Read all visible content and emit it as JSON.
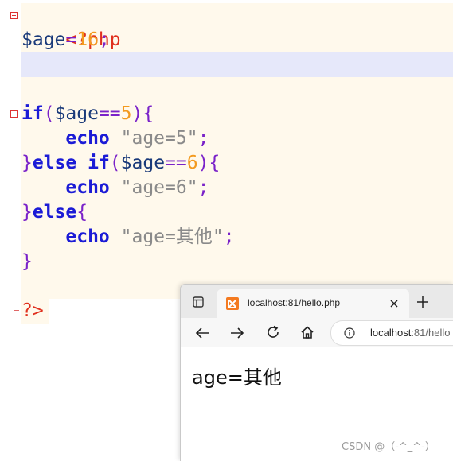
{
  "editor": {
    "open_tag": "<?php",
    "close_tag": "?>",
    "lines": {
      "assign": {
        "var": "$age",
        "op": "=",
        "num": "16",
        "end": ";"
      },
      "if": {
        "kw": "if",
        "open": "(",
        "var": "$age",
        "op": "==",
        "num": "5",
        "close": ")",
        "brace": "{"
      },
      "echo1": {
        "kw": "echo",
        "str": "\"age=5\"",
        "end": ";"
      },
      "elseif": {
        "brace_close": "}",
        "kw": "else if",
        "open": "(",
        "var": "$age",
        "op": "==",
        "num": "6",
        "close": ")",
        "brace": "{"
      },
      "echo2": {
        "kw": "echo",
        "str": "\"age=6\"",
        "end": ";"
      },
      "else": {
        "brace_close": "}",
        "kw": "else",
        "brace": "{"
      },
      "echo3": {
        "kw": "echo",
        "str": "\"age=其他\"",
        "end": ";"
      },
      "endbrace": "}"
    },
    "colors": {
      "keyword": "#1b1bd6",
      "number": "#f39a1e",
      "string": "#8a8a8a",
      "php_tag": "#e0301e",
      "bracket": "#7a22c9",
      "caret_line": "#e6e8fa",
      "background": "#fff9ec"
    }
  },
  "browser": {
    "tab_title": "localhost:81/hello.php",
    "url_host": "localhost",
    "url_rest": ":81/hello",
    "page_text": "age=其他",
    "icons": {
      "sidebar": "sidebar-icon",
      "favicon": "xampp-favicon",
      "close_tab": "close-icon",
      "new_tab": "plus-icon",
      "back": "back-arrow-icon",
      "forward": "forward-arrow-icon",
      "reload": "reload-icon",
      "home": "home-icon",
      "info": "info-icon"
    }
  },
  "watermark": "CSDN @（-^_^-）"
}
